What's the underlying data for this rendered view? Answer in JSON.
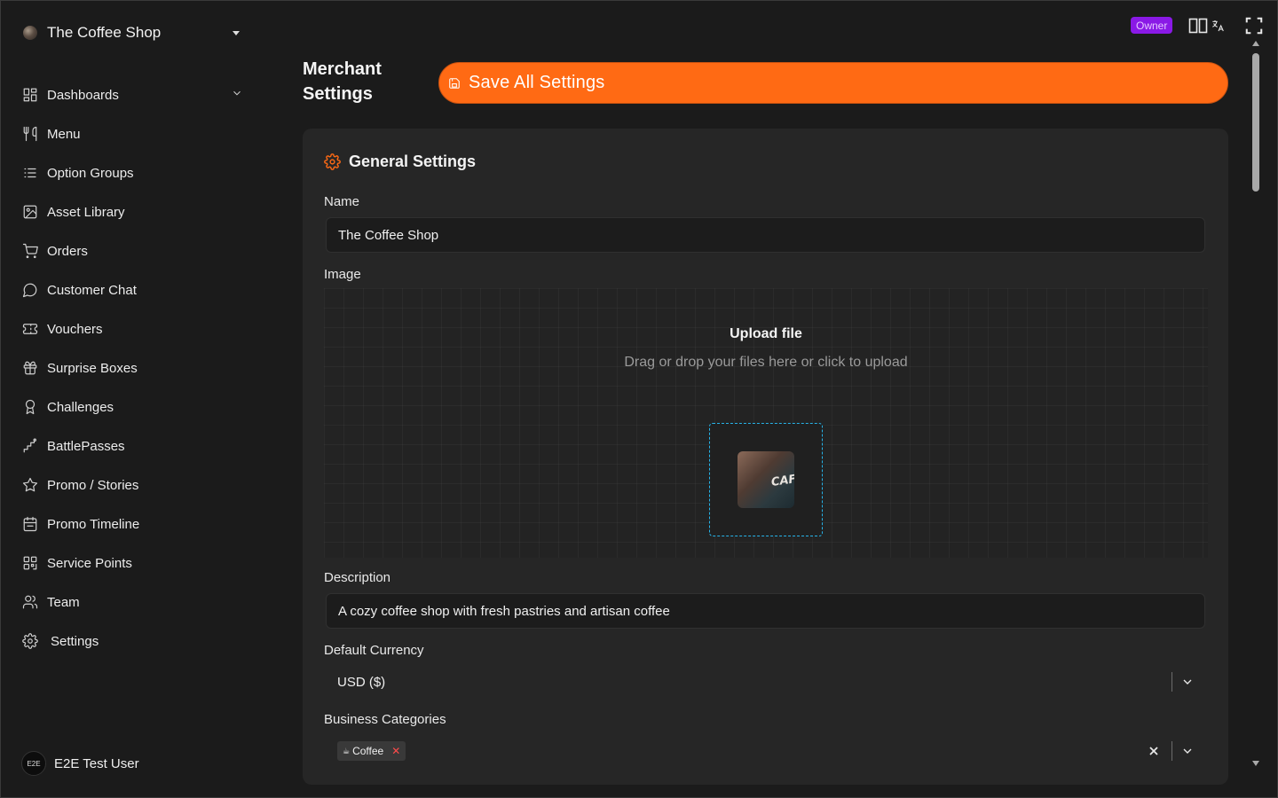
{
  "sidebar": {
    "brand": {
      "name": "The Coffee Shop"
    },
    "items": [
      {
        "label": "Dashboards",
        "icon": "dashboard-grid-icon"
      },
      {
        "label": "Menu",
        "icon": "utensils-icon"
      },
      {
        "label": "Option Groups",
        "icon": "list-icon"
      },
      {
        "label": "Asset Library",
        "icon": "image-icon"
      },
      {
        "label": "Orders",
        "icon": "cart-icon"
      },
      {
        "label": "Customer Chat",
        "icon": "chat-bubble-icon"
      },
      {
        "label": "Vouchers",
        "icon": "ticket-icon"
      },
      {
        "label": "Surprise Boxes",
        "icon": "gift-icon"
      },
      {
        "label": "Challenges",
        "icon": "award-icon"
      },
      {
        "label": "BattlePasses",
        "icon": "stairs-icon"
      },
      {
        "label": "Promo / Stories",
        "icon": "star-icon"
      },
      {
        "label": "Promo Timeline",
        "icon": "calendar-icon"
      },
      {
        "label": "Service Points",
        "icon": "qr-code-icon"
      },
      {
        "label": "Team",
        "icon": "users-icon"
      },
      {
        "label": "Settings",
        "icon": "gear-icon"
      }
    ],
    "user": {
      "avatar_text": "E2E",
      "name": "E2E Test User"
    }
  },
  "topbar": {
    "role_badge": "Owner",
    "icons": [
      "split-view-icon",
      "translate-icon",
      "fullscreen-icon"
    ]
  },
  "header": {
    "title": "Merchant Settings",
    "save_label": "Save All Settings"
  },
  "general": {
    "title": "General Settings",
    "name_label": "Name",
    "name_value": "The Coffee Shop",
    "image_label": "Image",
    "upload_title": "Upload file",
    "upload_sub": "Drag or drop your files here or click to upload",
    "image_thumb_text": "CAF",
    "description_label": "Description",
    "description_value": "A cozy coffee shop with fresh pastries and artisan coffee",
    "currency_label": "Default Currency",
    "currency_value": "USD ($)",
    "categories_label": "Business Categories",
    "categories": [
      {
        "emoji": "☕",
        "label": "Coffee"
      }
    ]
  },
  "colors": {
    "accent": "#ff6a14",
    "owner_badge": "#8a19e6",
    "upload_border": "#27b3e8",
    "background": "#1b1b1b",
    "card": "#262626"
  }
}
